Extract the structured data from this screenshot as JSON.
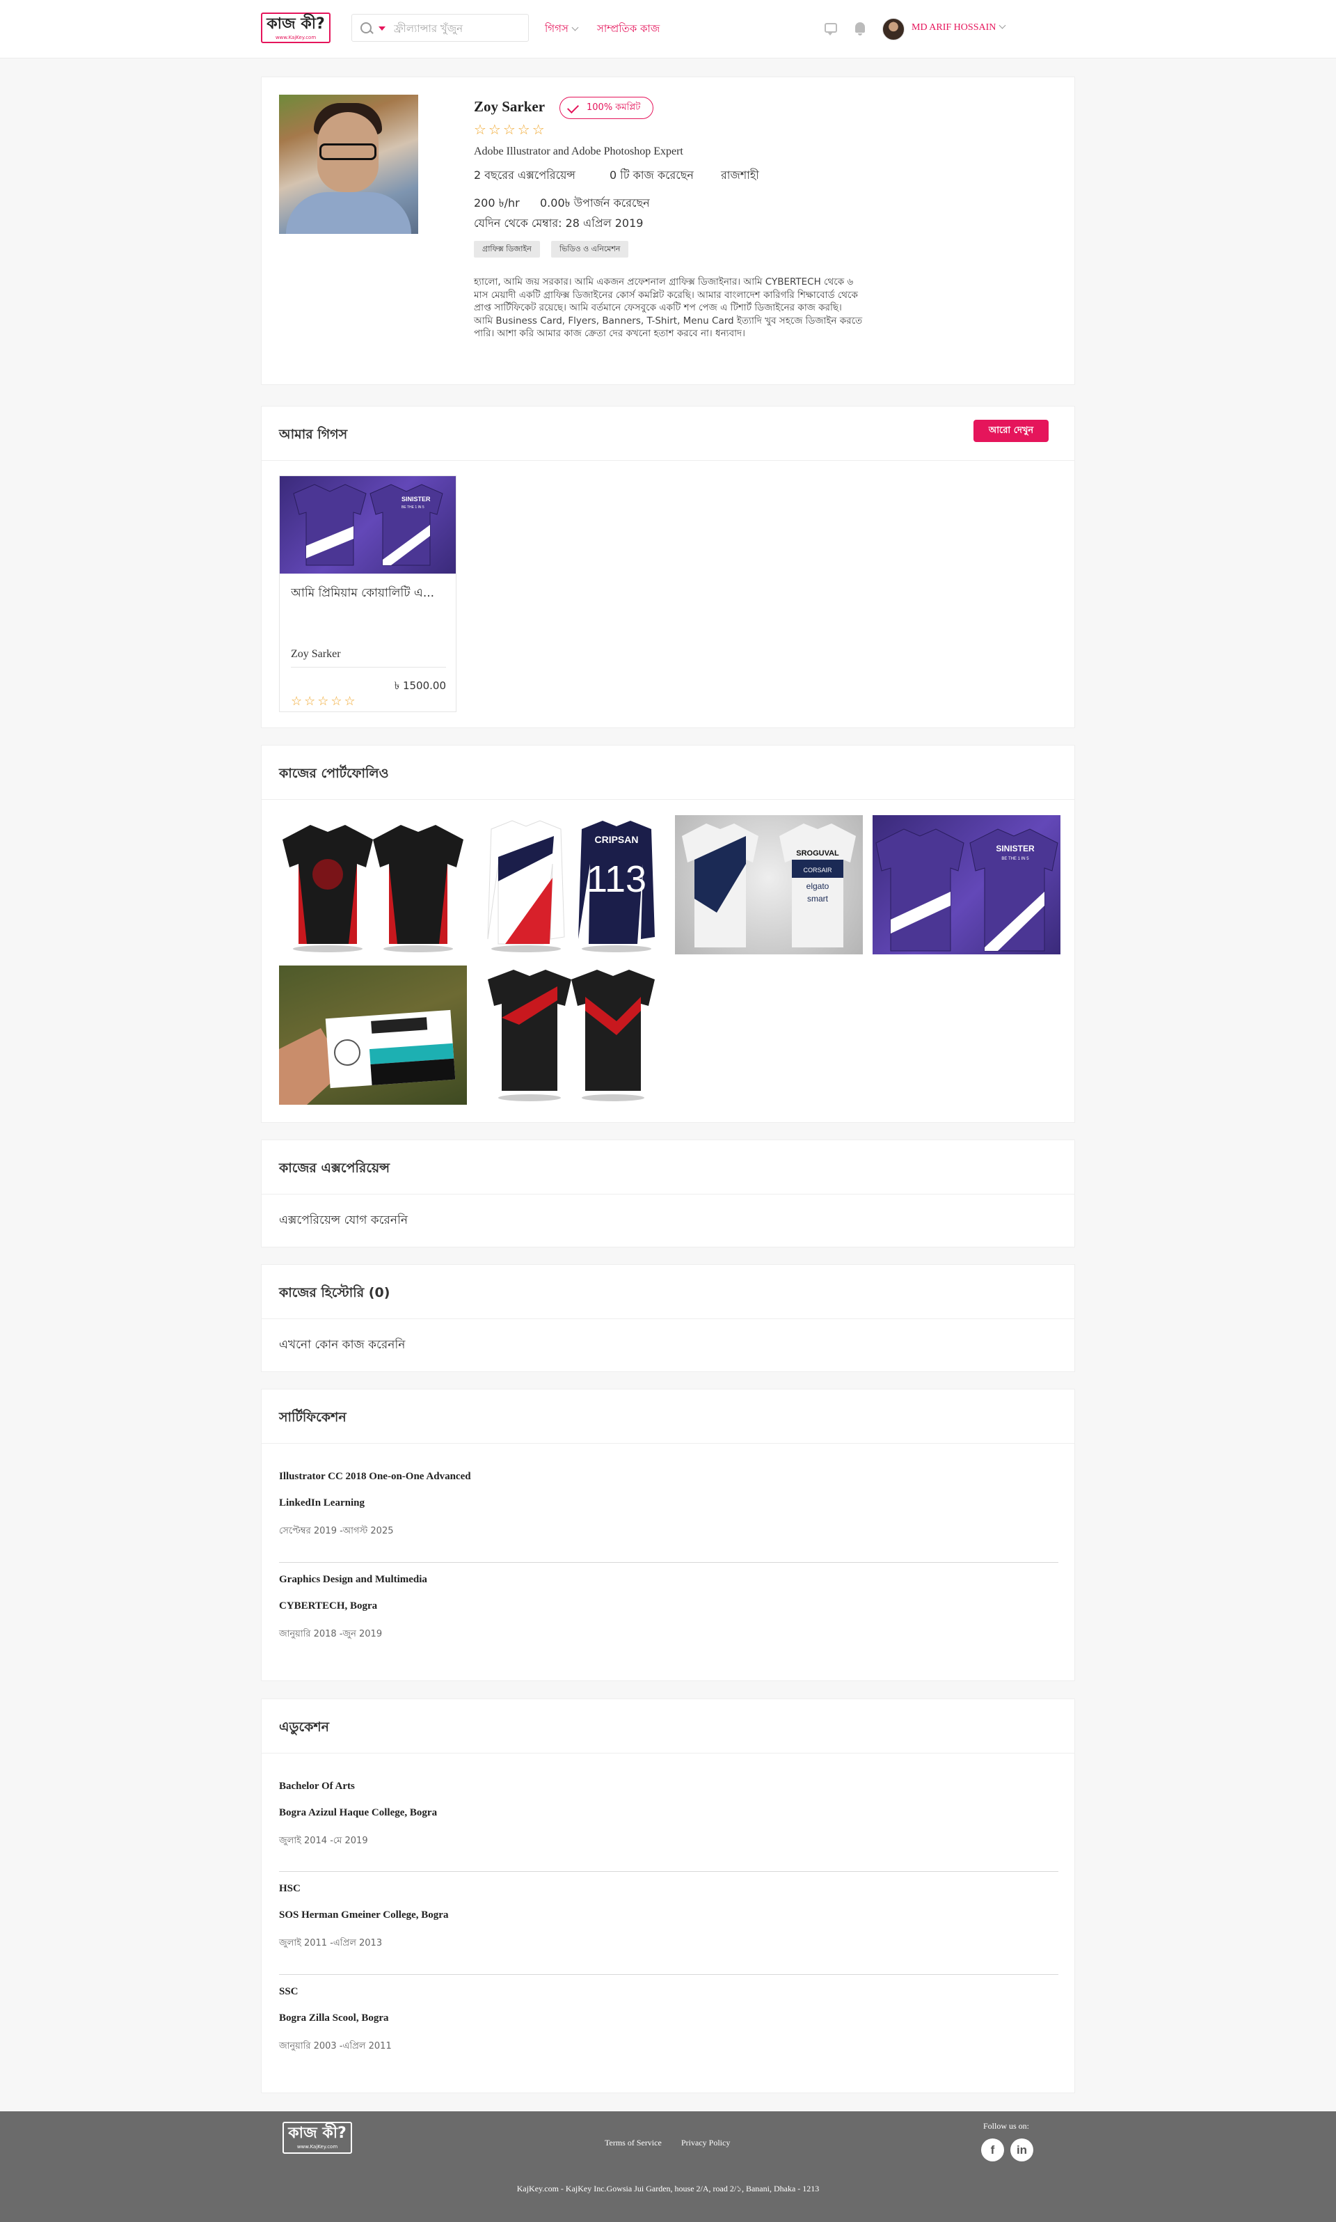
{
  "header": {
    "logo_text": "কাজ কী?",
    "logo_sub": "www.KajKey.com",
    "search_placeholder": "ফ্রীল্যান্সার খুঁজুন",
    "nav_gigs": "গিগস",
    "nav_recent_jobs": "সাম্প্রতিক কাজ",
    "user_name": "MD ARIF HOSSAIN"
  },
  "profile": {
    "name": "Zoy Sarker",
    "completion_badge": "100% কমপ্লিট",
    "stars": "☆☆☆☆☆",
    "headline": "Adobe Illustrator and Adobe Photoshop Expert",
    "experience": "2 বছরের এক্সপেরিয়েন্স",
    "jobs_done": "0 টি কাজ করেছেন",
    "location": "রাজশাহী",
    "rate": "200 ৳/hr",
    "earned": "0.00৳ উপার্জন করেছেন",
    "member_since": "যেদিন থেকে মেম্বার: 28 এপ্রিল 2019",
    "tags": [
      "গ্রাফিক্স ডিজাইন",
      "ভিডিও ও এনিমেশন"
    ],
    "bio": "হ্যালো, আমি জয় সরকার। আমি একজন প্রফেশনাল গ্রাফিক্স ডিজাইনার। আমি CYBERTECH থেকে ৬ মাস মেয়াদী একটি গ্রাফিক্স ডিজাইনের কোর্স কমপ্লিট করেছি। আমার বাংলাদেশ কারিগরি শিক্ষাবোর্ড থেকে প্রাপ্ত সার্টিফিকেট রয়েছে। আমি বর্তমানে ফেসবুকে একটি শপ পেজ এ টিশার্ট ডিজাইনের কাজ করছি। আমি Business Card, Flyers, Banners, T-Shirt, Menu Card ইত্যাদি খুব সহজে ডিজাইন করতে পারি। আশা করি আমার কাজ ক্রেতা দের কখনো হতাশ করবে না। ধন্যবাদ।"
  },
  "gigs": {
    "title": "আমার গিগস",
    "more_button": "আরো দেখুন",
    "items": [
      {
        "thumb_brand": "SINISTER",
        "thumb_tag": "BE THE 1 IN 5",
        "title": "আমি প্রিমিয়াম কোয়ালিটি এ...",
        "seller": "Zoy Sarker",
        "price": "৳ 1500.00",
        "stars": "☆☆☆☆☆"
      }
    ]
  },
  "portfolio": {
    "title": "কাজের পোর্টফোলিও",
    "texts": {
      "cripsan": "CRIPSAN",
      "number": "113",
      "sponsor1": "SROGUVAL",
      "sponsor2": "CORSAIR",
      "sponsor3": "elgato",
      "sponsor4": "smart",
      "sinister": "SINISTER",
      "sinister_tag": "BE THE 1 IN 5"
    }
  },
  "experience": {
    "title": "কাজের এক্সপেরিয়েন্স",
    "empty_text": "এক্সপেরিয়েন্স যোগ করেননি"
  },
  "history": {
    "title": "কাজের হিস্টোরি (0)",
    "empty_text": "এখনো কোন কাজ করেননি"
  },
  "certifications": {
    "title": "সার্টিফিকেশন",
    "items": [
      {
        "name": "Illustrator CC 2018 One-on-One Advanced",
        "issuer": "LinkedIn Learning",
        "dates": "সেপ্টেম্বর 2019 -আগস্ট 2025"
      },
      {
        "name": "Graphics Design and Multimedia",
        "issuer": "CYBERTECH, Bogra",
        "dates": "জানুয়ারি 2018 -জুন 2019"
      }
    ]
  },
  "education": {
    "title": "এডুকেশন",
    "items": [
      {
        "degree": "Bachelor Of Arts",
        "institution": "Bogra Azizul Haque College, Bogra",
        "dates": "জুলাই 2014 -মে 2019"
      },
      {
        "degree": "HSC",
        "institution": "SOS Herman Gmeiner College, Bogra",
        "dates": "জুলাই 2011 -এপ্রিল 2013"
      },
      {
        "degree": "SSC",
        "institution": "Bogra Zilla Scool, Bogra",
        "dates": "জানুয়ারি 2003 -এপ্রিল 2011"
      }
    ]
  },
  "footer": {
    "logo_text": "কাজ কী?",
    "logo_sub": "www.KajKey.com",
    "terms": "Terms of Service",
    "privacy": "Privacy Policy",
    "follow": "Follow us on:",
    "facebook": "f",
    "linkedin": "in",
    "address": "KajKey.com - KajKey Inc.Gowsia Jui Garden, house 2/A, road 2/১, Banani, Dhaka - 1213"
  },
  "colors": {
    "accent": "#e5155b",
    "footer_bg": "#6b6b6b",
    "page_bg": "#f7f7f7"
  },
  "icons": [
    "search-icon",
    "chevron-down-icon",
    "message-icon",
    "bell-icon",
    "check-icon",
    "facebook-icon",
    "linkedin-icon"
  ]
}
